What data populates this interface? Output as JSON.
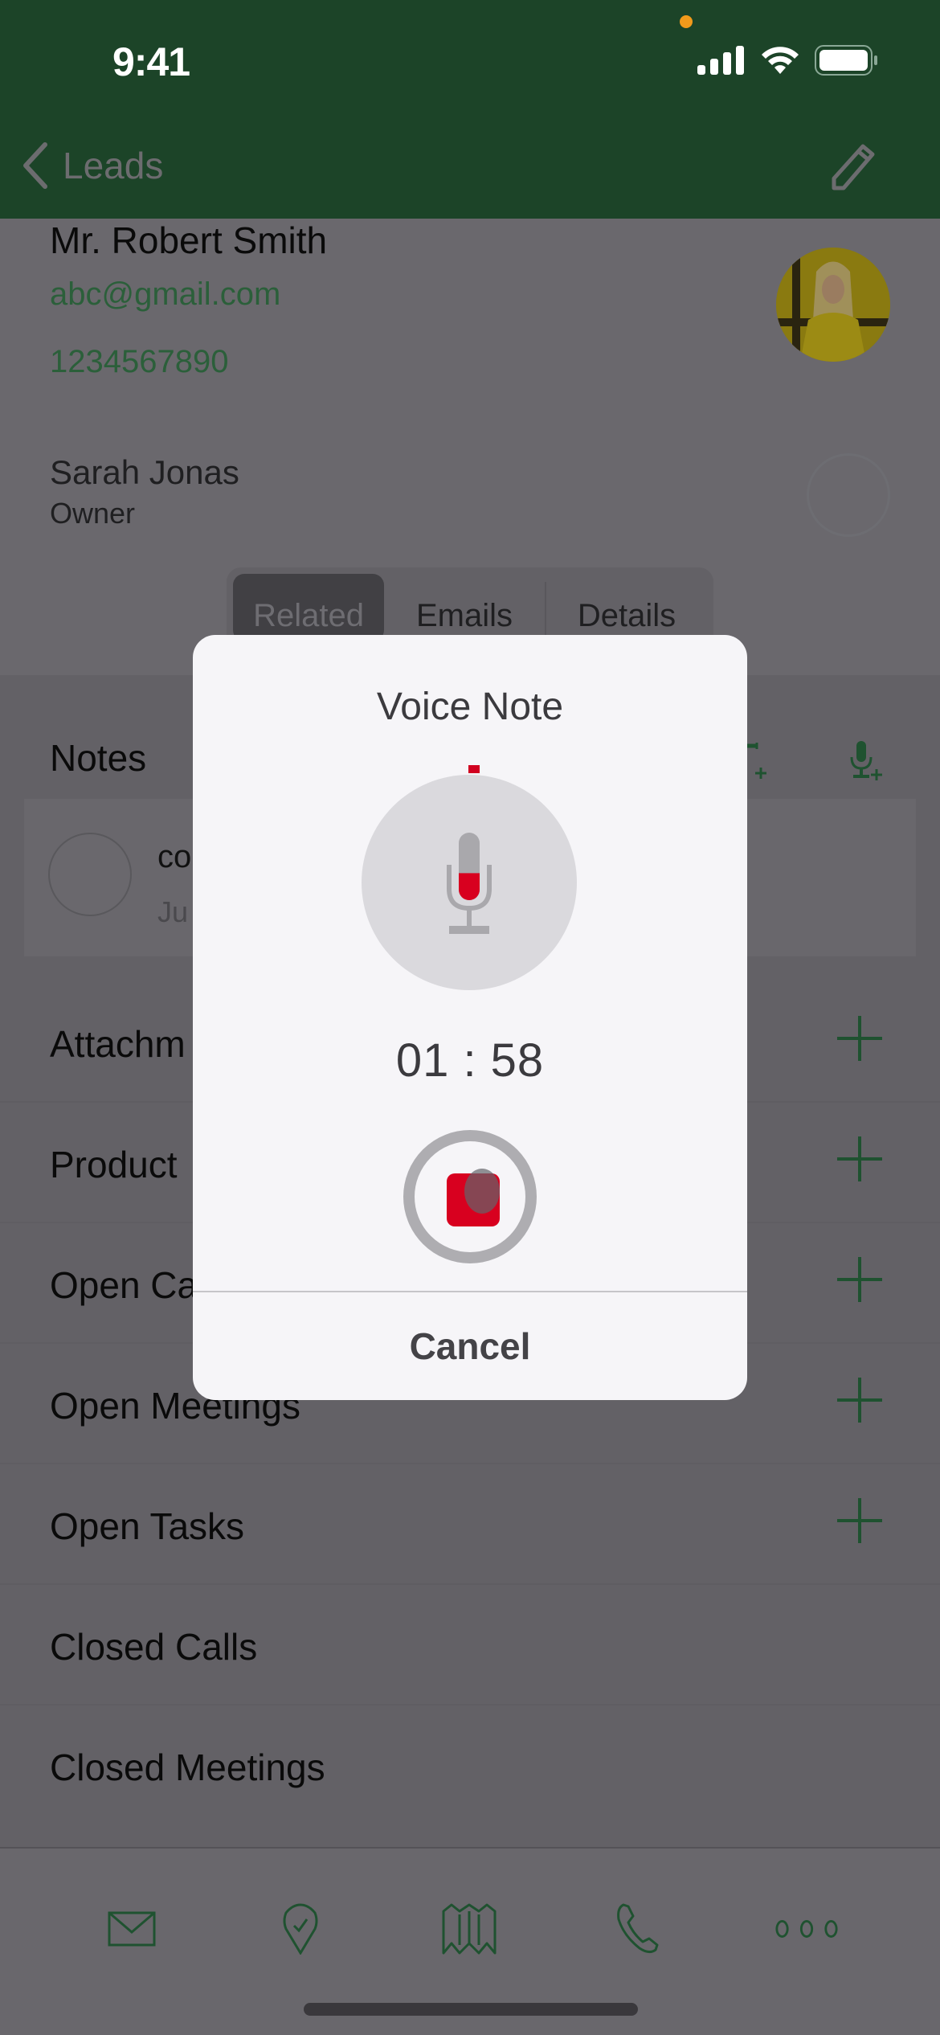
{
  "status_bar": {
    "time": "9:41",
    "icons": [
      "cellular-signal-icon",
      "wifi-icon",
      "battery-icon"
    ],
    "privacy_indicator_color": "#f19a1b"
  },
  "nav": {
    "back_label": "Leads",
    "back_icon": "chevron-left-icon",
    "edit_icon": "pencil-icon",
    "bar_color": "#1c4428"
  },
  "contact": {
    "name": "Mr. Robert Smith",
    "email": "abc@gmail.com",
    "phone": "1234567890",
    "owner_name": "Sarah Jonas",
    "owner_role": "Owner"
  },
  "tabs": [
    {
      "label": "Related",
      "active": true
    },
    {
      "label": "Emails",
      "active": false
    },
    {
      "label": "Details",
      "active": false
    }
  ],
  "notes": {
    "title": "Notes",
    "actions": [
      "add-text-note-icon",
      "add-voice-note-icon"
    ],
    "items": [
      {
        "title": "co",
        "subtitle": "Ju"
      }
    ]
  },
  "related_sections": [
    {
      "label": "Attachm",
      "has_add": true
    },
    {
      "label": "Product",
      "has_add": true
    },
    {
      "label": "Open Ca",
      "has_add": true
    },
    {
      "label": "Open Meetings",
      "has_add": true
    },
    {
      "label": "Open Tasks",
      "has_add": true
    },
    {
      "label": "Closed Calls",
      "has_add": false
    },
    {
      "label": "Closed Meetings",
      "has_add": false
    }
  ],
  "bottom_bar": {
    "items": [
      "mail-icon",
      "location-check-icon",
      "map-icon",
      "phone-icon",
      "more-icon"
    ],
    "accent": "#1f5230"
  },
  "voice_note_dialog": {
    "title": "Voice Note",
    "timer": "01 : 58",
    "progress_fraction": 0.01,
    "mic_level_fraction": 0.4,
    "cancel_label": "Cancel",
    "record_color": "#d8001f"
  }
}
